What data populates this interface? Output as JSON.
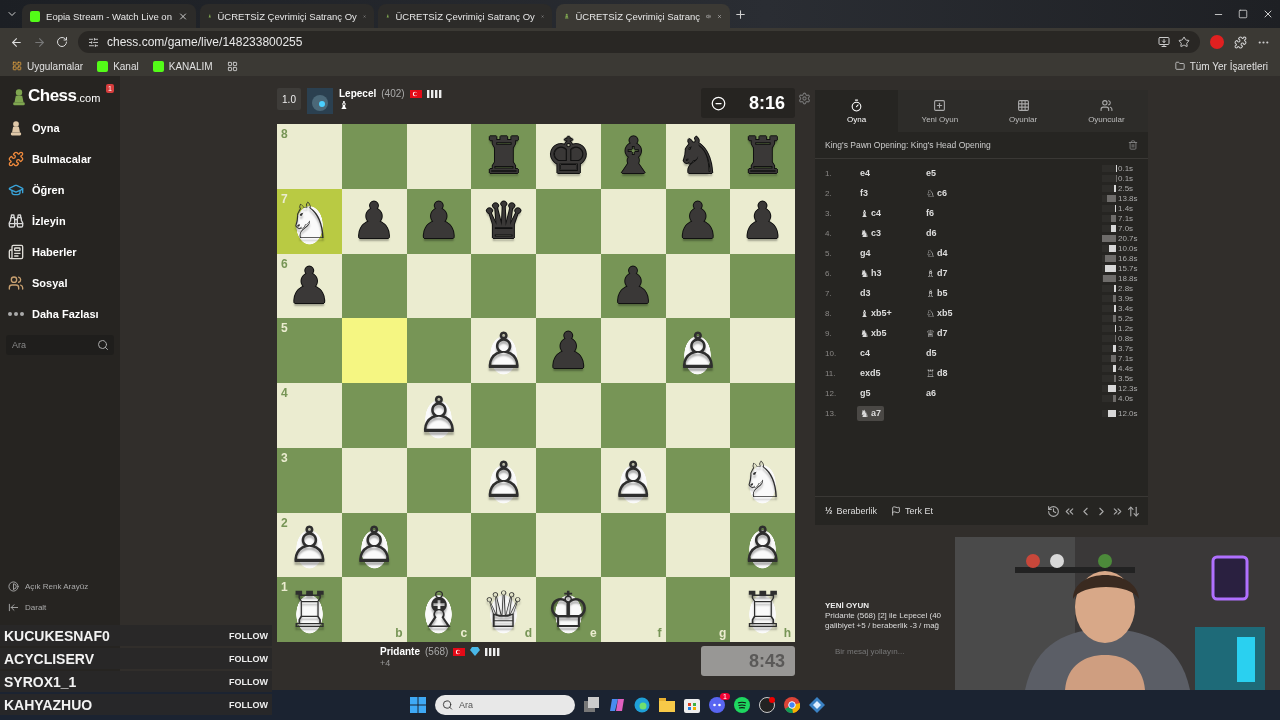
{
  "browser": {
    "tabs": [
      {
        "title": "Eopia Stream - Watch Live on",
        "kind": "stream",
        "selected": false
      },
      {
        "title": "ÜCRETSİZ Çevrimiçi Satranç Oy",
        "kind": "chess",
        "selected": false
      },
      {
        "title": "ÜCRETSİZ Çevrimiçi Satranç Oy",
        "kind": "chess",
        "selected": false
      },
      {
        "title": "ÜCRETSİZ Çevrimiçi Satranç",
        "kind": "chess",
        "selected": true
      }
    ],
    "url": "chess.com/game/live/148233800255",
    "bookmarks": [
      {
        "label": "Uygulamalar",
        "kind": "apps"
      },
      {
        "label": "Kanal",
        "kind": "stream"
      },
      {
        "label": "KANALIM",
        "kind": "stream"
      }
    ],
    "all_bookmarks": "Tüm Yer İşaretleri"
  },
  "sidebar": {
    "logo": "Chess",
    "logo_suffix": ".com",
    "badge": "1",
    "items": [
      {
        "label": "Oyna"
      },
      {
        "label": "Bulmacalar"
      },
      {
        "label": "Öğren"
      },
      {
        "label": "İzleyin"
      },
      {
        "label": "Haberler"
      },
      {
        "label": "Sosyal"
      },
      {
        "label": "Daha Fazlası"
      }
    ],
    "search": {
      "placeholder": "Ara"
    },
    "footer": [
      {
        "label": "Açık Renk Arayüz"
      },
      {
        "label": "Daralt"
      }
    ]
  },
  "top_player": {
    "score": "1.0",
    "name": "Lepecel",
    "rating": "(402)",
    "captured": "♝",
    "clock": "8:16",
    "running": true
  },
  "bottom_player": {
    "name": "Pridante",
    "rating": "(568)",
    "advantage": "+4",
    "clock": "8:43",
    "running": false
  },
  "board": {
    "ranks": [
      {
        "label": "8",
        "squares": [
          {
            "highlighted": false
          },
          {
            "highlighted": false
          },
          {
            "highlighted": false
          },
          {
            "piece": "♜",
            "kind": "black",
            "highlighted": false
          },
          {
            "piece": "♚",
            "kind": "black",
            "highlighted": false
          },
          {
            "piece": "♝",
            "kind": "black",
            "highlighted": false
          },
          {
            "piece": "♞",
            "kind": "black",
            "highlighted": false
          },
          {
            "piece": "♜",
            "kind": "black",
            "highlighted": false
          }
        ]
      },
      {
        "label": "7",
        "squares": [
          {
            "piece": "♘",
            "kind": "white",
            "highlighted": true
          },
          {
            "piece": "♟",
            "kind": "black",
            "highlighted": false
          },
          {
            "piece": "♟",
            "kind": "black",
            "highlighted": false
          },
          {
            "piece": "♛",
            "kind": "black",
            "highlighted": false
          },
          {
            "highlighted": false
          },
          {
            "highlighted": false
          },
          {
            "piece": "♟",
            "kind": "black",
            "highlighted": false
          },
          {
            "piece": "♟",
            "kind": "black",
            "highlighted": false
          }
        ]
      },
      {
        "label": "6",
        "squares": [
          {
            "piece": "♟",
            "kind": "black",
            "highlighted": false
          },
          {
            "highlighted": false
          },
          {
            "highlighted": false
          },
          {
            "highlighted": false
          },
          {
            "highlighted": false
          },
          {
            "piece": "♟",
            "kind": "black",
            "highlighted": false
          },
          {
            "highlighted": false
          },
          {
            "highlighted": false
          }
        ]
      },
      {
        "label": "5",
        "squares": [
          {
            "highlighted": false
          },
          {
            "highlighted": true
          },
          {
            "highlighted": false
          },
          {
            "piece": "♙",
            "kind": "white",
            "highlighted": false
          },
          {
            "piece": "♟",
            "kind": "black",
            "highlighted": false
          },
          {
            "highlighted": false
          },
          {
            "piece": "♙",
            "kind": "white",
            "highlighted": false
          },
          {
            "highlighted": false
          }
        ]
      },
      {
        "label": "4",
        "squares": [
          {
            "highlighted": false
          },
          {
            "highlighted": false
          },
          {
            "piece": "♙",
            "kind": "white",
            "highlighted": false
          },
          {
            "highlighted": false
          },
          {
            "highlighted": false
          },
          {
            "highlighted": false
          },
          {
            "highlighted": false
          },
          {
            "highlighted": false
          }
        ]
      },
      {
        "label": "3",
        "squares": [
          {
            "highlighted": false
          },
          {
            "highlighted": false
          },
          {
            "highlighted": false
          },
          {
            "piece": "♙",
            "kind": "white",
            "highlighted": false
          },
          {
            "highlighted": false
          },
          {
            "piece": "♙",
            "kind": "white",
            "highlighted": false
          },
          {
            "highlighted": false
          },
          {
            "piece": "♘",
            "kind": "white",
            "highlighted": false
          }
        ]
      },
      {
        "label": "2",
        "squares": [
          {
            "piece": "♙",
            "kind": "white",
            "highlighted": false
          },
          {
            "piece": "♙",
            "kind": "white",
            "highlighted": false
          },
          {
            "highlighted": false
          },
          {
            "highlighted": false
          },
          {
            "highlighted": false
          },
          {
            "highlighted": false
          },
          {
            "highlighted": false
          },
          {
            "piece": "♙",
            "kind": "white",
            "highlighted": false
          }
        ]
      },
      {
        "label": "1",
        "squares": [
          {
            "piece": "♖",
            "kind": "white",
            "highlighted": false
          },
          {
            "file": "b",
            "highlighted": false
          },
          {
            "piece": "♗",
            "kind": "white",
            "file": "c",
            "highlighted": false
          },
          {
            "piece": "♕",
            "kind": "white",
            "file": "d",
            "highlighted": false
          },
          {
            "piece": "♔",
            "kind": "white",
            "file": "e",
            "highlighted": false
          },
          {
            "file": "f",
            "highlighted": false
          },
          {
            "file": "g",
            "highlighted": false
          },
          {
            "piece": "♖",
            "kind": "white",
            "file": "h",
            "highlighted": false
          }
        ]
      }
    ]
  },
  "panel": {
    "tabs": [
      {
        "label": "Oyna",
        "selected": true
      },
      {
        "label": "Yeni Oyun",
        "selected": false
      },
      {
        "label": "Oyunlar",
        "selected": false
      },
      {
        "label": "Oyuncular",
        "selected": false
      }
    ],
    "opening": "King's Pawn Opening: King's Head Opening",
    "moves": [
      {
        "number": "1.",
        "white": {
          "san": "e4",
          "time": "0.1s",
          "level": 0.01,
          "selected": false
        },
        "black": {
          "san": "e5",
          "time": "0.1s",
          "level": 0.01,
          "selected": false
        }
      },
      {
        "number": "2.",
        "white": {
          "san": "f3",
          "time": "2.5s",
          "level": 0.12,
          "selected": false
        },
        "black": {
          "piece": "♘",
          "san": "c6",
          "time": "13.8s",
          "level": 0.67,
          "selected": false
        }
      },
      {
        "number": "3.",
        "white": {
          "piece": "♝",
          "san": "c4",
          "time": "1.4s",
          "level": 0.07,
          "selected": false
        },
        "black": {
          "san": "f6",
          "time": "7.1s",
          "level": 0.34,
          "selected": false
        }
      },
      {
        "number": "4.",
        "white": {
          "piece": "♞",
          "san": "c3",
          "time": "7.0s",
          "level": 0.34,
          "selected": false
        },
        "black": {
          "san": "d6",
          "time": "20.7s",
          "level": 1,
          "selected": false
        }
      },
      {
        "number": "5.",
        "white": {
          "san": "g4",
          "time": "10.0s",
          "level": 0.48,
          "selected": false
        },
        "black": {
          "piece": "♘",
          "san": "d4",
          "time": "16.8s",
          "level": 0.81,
          "selected": false
        }
      },
      {
        "number": "6.",
        "white": {
          "piece": "♞",
          "san": "h3",
          "time": "15.7s",
          "level": 0.76,
          "selected": false
        },
        "black": {
          "piece": "♗",
          "san": "d7",
          "time": "18.8s",
          "level": 0.91,
          "selected": false
        }
      },
      {
        "number": "7.",
        "white": {
          "san": "d3",
          "time": "2.8s",
          "level": 0.14,
          "selected": false
        },
        "black": {
          "piece": "♗",
          "san": "b5",
          "time": "3.9s",
          "level": 0.19,
          "selected": false
        }
      },
      {
        "number": "8.",
        "white": {
          "piece": "♝",
          "san": "xb5+",
          "time": "3.4s",
          "level": 0.16,
          "selected": false
        },
        "black": {
          "piece": "♘",
          "san": "xb5",
          "time": "5.2s",
          "level": 0.25,
          "selected": false
        }
      },
      {
        "number": "9.",
        "white": {
          "piece": "♞",
          "san": "xb5",
          "time": "1.2s",
          "level": 0.06,
          "selected": false
        },
        "black": {
          "piece": "♕",
          "san": "d7",
          "time": "0.8s",
          "level": 0.04,
          "selected": false
        }
      },
      {
        "number": "10.",
        "white": {
          "san": "c4",
          "time": "3.7s",
          "level": 0.18,
          "selected": false
        },
        "black": {
          "san": "d5",
          "time": "7.1s",
          "level": 0.34,
          "selected": false
        }
      },
      {
        "number": "11.",
        "white": {
          "san": "exd5",
          "time": "4.4s",
          "level": 0.21,
          "selected": false
        },
        "black": {
          "piece": "♖",
          "san": "d8",
          "time": "3.5s",
          "level": 0.17,
          "selected": false
        }
      },
      {
        "number": "12.",
        "white": {
          "san": "g5",
          "time": "12.3s",
          "level": 0.59,
          "selected": false
        },
        "black": {
          "san": "a6",
          "time": "4.0s",
          "level": 0.19,
          "selected": false
        }
      },
      {
        "number": "13.",
        "white": {
          "piece": "♞",
          "san": "a7",
          "time": "12.0s",
          "level": 0.58,
          "selected": true
        }
      }
    ],
    "draw": {
      "symbol": "½",
      "label": "Beraberlik"
    },
    "resign": "Terk Et"
  },
  "chat": {
    "heading": "YENİ OYUN",
    "lines": [
      "Pridante (568) [2] ile Lepecel (40",
      "galibiyet +5 / beraberlik -3 / mağ"
    ],
    "placeholder": "Bir mesaj yollayın..."
  },
  "followers": [
    {
      "name": "KUCUKESNAF0",
      "action": "FOLLOW"
    },
    {
      "name": "ACYCLISERV",
      "action": "FOLLOW"
    },
    {
      "name": "SYROX1_1",
      "action": "FOLLOW"
    },
    {
      "name": "KAHYAZHUO",
      "action": "FOLLOW"
    }
  ],
  "taskbar": {
    "search": {
      "placeholder": "Ara"
    },
    "discord_badge": "1"
  }
}
